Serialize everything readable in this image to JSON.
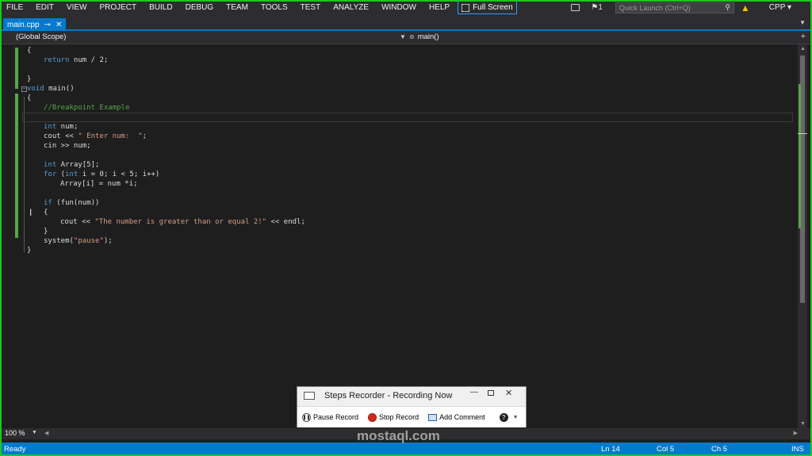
{
  "menu": [
    "FILE",
    "EDIT",
    "VIEW",
    "PROJECT",
    "BUILD",
    "DEBUG",
    "TEAM",
    "TOOLS",
    "TEST",
    "ANALYZE",
    "WINDOW",
    "HELP"
  ],
  "fullscreen_label": "Full Screen",
  "toolbar_right": {
    "notification_count": "1",
    "quick_launch_placeholder": "Quick Launch (Ctrl+Q)",
    "profile": "CPP"
  },
  "tab": {
    "label": "main.cpp",
    "pin": "⊸",
    "close": "✕"
  },
  "navbar": {
    "scope": "(Global Scope)",
    "member": "main()"
  },
  "code": {
    "l1": "{",
    "l2_kw": "return",
    "l2_rest": " num / 2;",
    "l3": "}",
    "l4_kw": "void",
    "l4_rest": " main()",
    "l5": "{",
    "l6": "//Breakpoint Example",
    "l8_kw": "int",
    "l8_rest": " num;",
    "l9_a": "cout << ",
    "l9_str": "\" Enter num:  \"",
    "l9_b": ";",
    "l10": "cin >> num;",
    "l12_kw": "int",
    "l12_rest": " Array[5];",
    "l13_kw": "for",
    "l13_a": " (",
    "l13_kw2": "int",
    "l13_b": " i = 0; i < 5; i++)",
    "l14": "Array[i] = num *i;",
    "l16_kw": "if",
    "l16_rest": " (fun(num))",
    "l17": "{",
    "l18_a": "cout << ",
    "l18_str": "\"The number is greater than or equal 2!\"",
    "l18_b": " << endl;",
    "l19": "}",
    "l20_a": "system(",
    "l20_str": "\"pause\"",
    "l20_b": ");",
    "l21": "}"
  },
  "zoom": "100 %",
  "status": {
    "ready": "Ready",
    "ln": "Ln 14",
    "col": "Col 5",
    "ch": "Ch 5",
    "ins": "INS"
  },
  "recorder": {
    "title": "Steps Recorder - Recording Now",
    "pause": "Pause Record",
    "stop": "Stop Record",
    "comment": "Add Comment"
  },
  "watermark": "mostaql.com",
  "colors": {
    "accent": "#007acc",
    "keyword": "#569cd6",
    "string": "#d69d85",
    "comment": "#57a64a",
    "frame": "#1ec71e"
  }
}
